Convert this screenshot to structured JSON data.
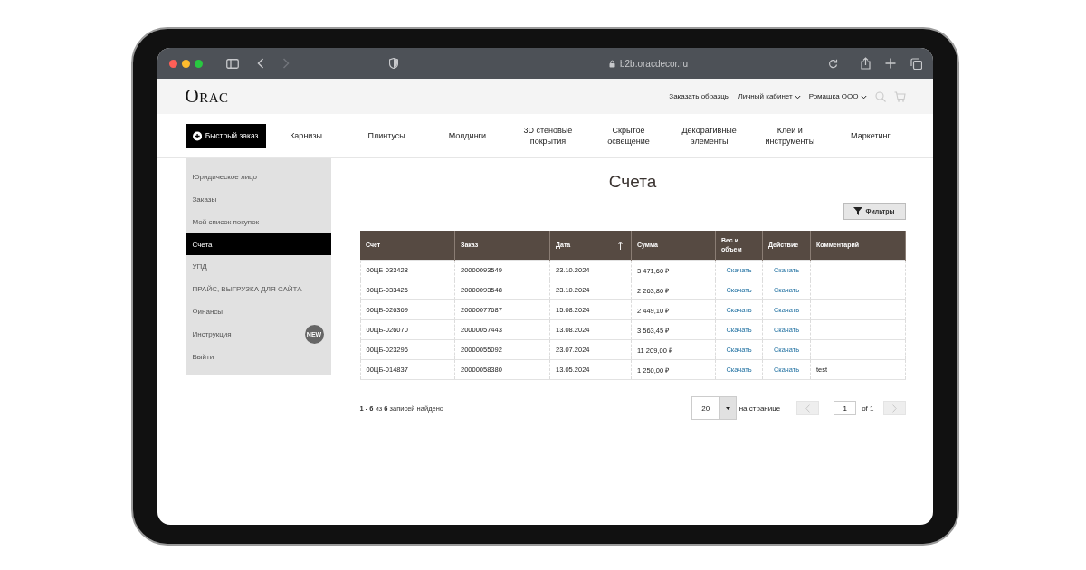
{
  "browser": {
    "url": "b2b.oracdecor.ru",
    "forward_disabled": true
  },
  "header": {
    "logo": "ORAC",
    "links": [
      {
        "label": "Заказать образцы",
        "dropdown": false
      },
      {
        "label": "Личный кабинет",
        "dropdown": true
      },
      {
        "label": "Ромашка ООО",
        "dropdown": true
      }
    ]
  },
  "nav": {
    "quick_order": "Быстрый заказ",
    "items": [
      "Карнизы",
      "Плинтусы",
      "Молдинги",
      "3D стеновые покрытия",
      "Скрытое освещение",
      "Декоративные элементы",
      "Клеи и инструменты",
      "Маркетинг"
    ]
  },
  "sidebar": {
    "items": [
      {
        "label": "Юридическое лицо",
        "selected": false
      },
      {
        "label": "Заказы",
        "selected": false
      },
      {
        "label": "Мой список покупок",
        "selected": false
      },
      {
        "label": "Счета",
        "selected": true
      },
      {
        "label": "УПД",
        "selected": false
      },
      {
        "label": "ПРАЙС, ВЫГРУЗКА ДЛЯ САЙТА",
        "selected": false
      },
      {
        "label": "Финансы",
        "selected": false
      },
      {
        "label": "Инструкция",
        "selected": false,
        "badge": "NEW"
      },
      {
        "label": "Выйти",
        "selected": false
      }
    ]
  },
  "page": {
    "title": "Счета",
    "filter_button": "Фильтры",
    "table": {
      "columns": [
        {
          "label": "Счет",
          "kind": "text",
          "sorted": false
        },
        {
          "label": "Заказ",
          "kind": "text",
          "sorted": false
        },
        {
          "label": "Дата",
          "kind": "text",
          "sorted": true
        },
        {
          "label": "Сумма",
          "kind": "text",
          "sorted": false
        },
        {
          "label": "Вес и объем",
          "kind": "link",
          "sorted": false
        },
        {
          "label": "Действие",
          "kind": "link",
          "sorted": false
        },
        {
          "label": "Комментарий",
          "kind": "text",
          "sorted": false
        }
      ],
      "rows": [
        {
          "cells": [
            "00ЦБ-033428",
            "20000093549",
            "23.10.2024",
            "3 471,60 ₽",
            "Скачать",
            "Скачать",
            null
          ]
        },
        {
          "cells": [
            "00ЦБ-033426",
            "20000093548",
            "23.10.2024",
            "2 263,80 ₽",
            "Скачать",
            "Скачать",
            null
          ]
        },
        {
          "cells": [
            "00ЦБ-026369",
            "20000077687",
            "15.08.2024",
            "2 449,10 ₽",
            "Скачать",
            "Скачать",
            null
          ]
        },
        {
          "cells": [
            "00ЦБ-026070",
            "20000057443",
            "13.08.2024",
            "3 563,45 ₽",
            "Скачать",
            "Скачать",
            null
          ]
        },
        {
          "cells": [
            "00ЦБ-023296",
            "20000055092",
            "23.07.2024",
            "11 209,00 ₽",
            "Скачать",
            "Скачать",
            null
          ]
        },
        {
          "cells": [
            "00ЦБ-014837",
            "20000058380",
            "13.05.2024",
            "1 250,00 ₽",
            "Скачать",
            "Скачать",
            "test"
          ]
        }
      ]
    },
    "pagination": {
      "summary": "**1 - 6** из **6** записей найдено",
      "per_page": "20",
      "per_page_label": "на странице",
      "prev_disabled": true,
      "page": "1",
      "of": "of 1",
      "next_disabled": true
    }
  }
}
